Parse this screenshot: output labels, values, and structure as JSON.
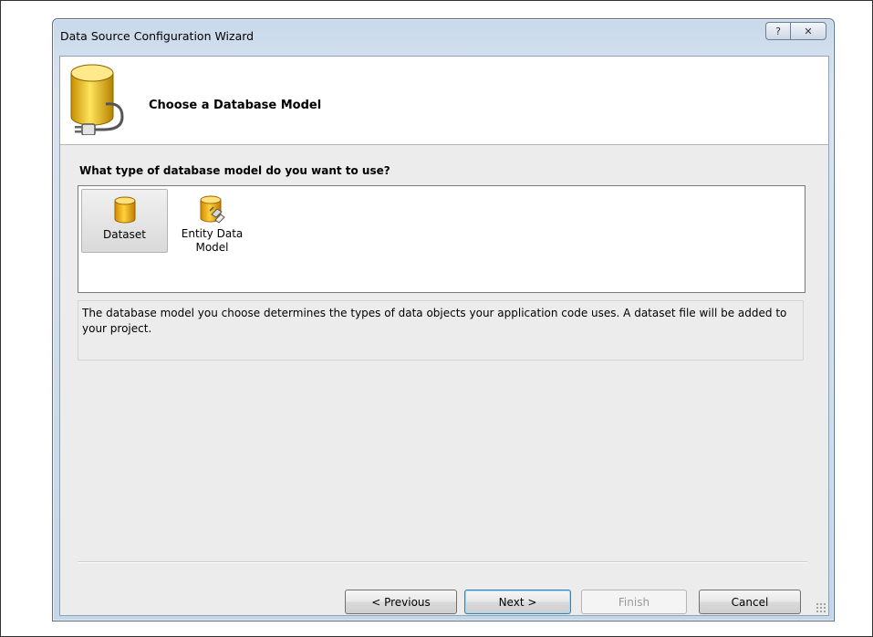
{
  "window": {
    "title": "Data Source Configuration Wizard",
    "help_button": "?",
    "close_button": "✕"
  },
  "header": {
    "title": "Choose a Database Model",
    "icon": "database-connection-icon"
  },
  "question": "What type of database model do you want to use?",
  "models": [
    {
      "label": "Dataset",
      "icon": "database-icon",
      "selected": true
    },
    {
      "label_line1": "Entity Data",
      "label_line2": "Model",
      "icon": "entity-data-model-icon",
      "selected": false
    }
  ],
  "description": "The database model you choose determines the types of data objects your application code uses. A dataset file will be added to your project.",
  "buttons": {
    "previous": "< Previous",
    "next": "Next >",
    "finish": "Finish",
    "cancel": "Cancel"
  },
  "colors": {
    "db_gold": "#e8b400",
    "frame_blue": "#c9d9ea"
  }
}
